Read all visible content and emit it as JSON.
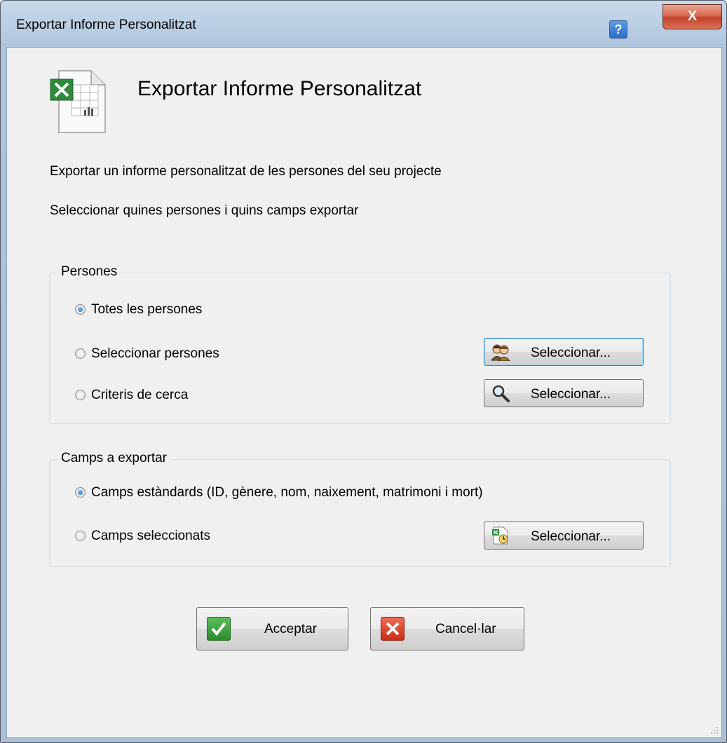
{
  "window": {
    "title": "Exportar Informe Personalitzat",
    "help_label": "?",
    "close_label": "X"
  },
  "header": {
    "icon": "excel-document-icon",
    "title": "Exportar Informe Personalitzat"
  },
  "description": {
    "line1": "Exportar un informe personalitzat de les persones del seu projecte",
    "line2": "Seleccionar quines persones i quins camps exportar"
  },
  "persons_group": {
    "title": "Persones",
    "options": [
      {
        "label": "Totes les persones",
        "checked": true
      },
      {
        "label": "Seleccionar persones",
        "checked": false,
        "button_label": "Seleccionar...",
        "button_icon": "people-icon"
      },
      {
        "label": "Criteris de cerca",
        "checked": false,
        "button_label": "Seleccionar...",
        "button_icon": "magnifier-icon"
      }
    ]
  },
  "fields_group": {
    "title": "Camps a exportar",
    "options": [
      {
        "label": "Camps estàndards (ID, gènere, nom, naixement, matrimoni i mort)",
        "checked": true
      },
      {
        "label": "Camps seleccionats",
        "checked": false,
        "button_label": "Seleccionar...",
        "button_icon": "spreadsheet-fields-icon"
      }
    ]
  },
  "actions": {
    "accept_label": "Acceptar",
    "cancel_label": "Cancel·lar",
    "accept_icon": "checkmark-icon",
    "cancel_icon": "cross-icon"
  },
  "colors": {
    "accept_green": "#3aa23a",
    "cancel_red": "#e0442a",
    "focus_blue": "#3c7fb1"
  }
}
